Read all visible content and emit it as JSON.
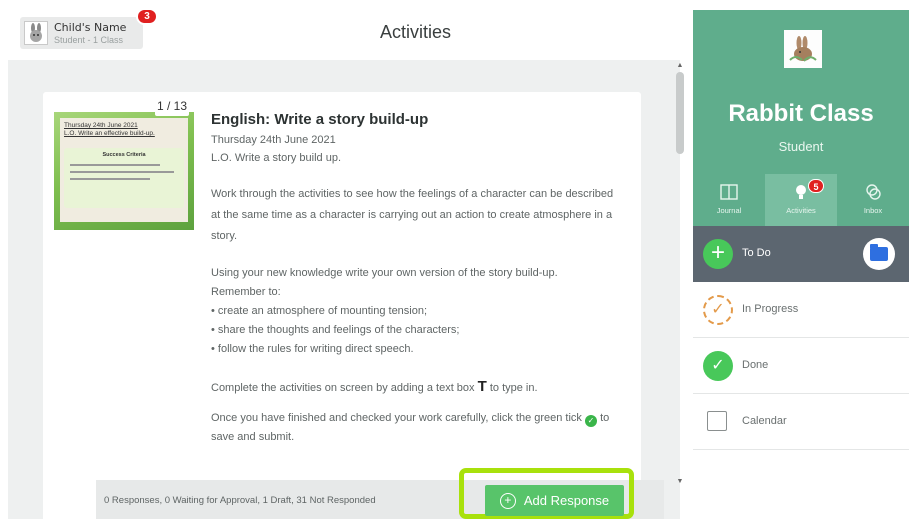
{
  "header": {
    "child_name": "Child's Name",
    "child_class": "Student - 1 Class",
    "notification_count": "3",
    "title": "Activities"
  },
  "activity": {
    "thumbnail": {
      "date_line": "Thursday 24th June 2021",
      "lo_line": "L.O. Write an effective build-up.",
      "criteria_title": "Success Criteria",
      "page_count": "1 / 13"
    },
    "title": "English: Write a story build-up",
    "date": "Thursday 24th June 2021",
    "lo": "L.O. Write a story build up.",
    "paragraph1": "Work through the activities to see how the feelings of a character can be described at the same time as a character is carrying out an action to create atmosphere in a story.",
    "paragraph2": "Using your new knowledge write your own version of the story build-up.",
    "remember": "Remember to:",
    "bullets": [
      "• create an atmosphere of mounting tension;",
      "• share the thoughts and feelings of the characters;",
      "• follow the rules for writing direct speech."
    ],
    "instruction1_a": "Complete the activities on screen by adding a text box",
    "instruction1_icon": "T",
    "instruction1_b": "to type in.",
    "instruction2_a": "Once you have finished and checked your work carefully, click the green tick",
    "instruction2_b": "to",
    "instruction2_c": "save and submit."
  },
  "footer": {
    "summary": "0 Responses, 0 Waiting for Approval, 1 Draft, 31 Not Responded",
    "add_label": "Add Response"
  },
  "sidebar": {
    "class_name": "Rabbit Class",
    "role": "Student",
    "tabs": [
      {
        "label": "Journal",
        "icon": "book-icon"
      },
      {
        "label": "Activities",
        "icon": "bulb-icon",
        "badge": "5"
      },
      {
        "label": "Inbox",
        "icon": "chat-icon"
      }
    ],
    "todo_label": "To Do",
    "statuses": [
      {
        "label": "In Progress",
        "icon": "progress-icon"
      },
      {
        "label": "Done",
        "icon": "check-icon"
      },
      {
        "label": "Calendar",
        "icon": "calendar-icon"
      }
    ]
  },
  "colors": {
    "brand_green": "#5fad8c",
    "highlight": "#a8e10c",
    "button_green": "#58c46a",
    "badge_red": "#e02020"
  }
}
